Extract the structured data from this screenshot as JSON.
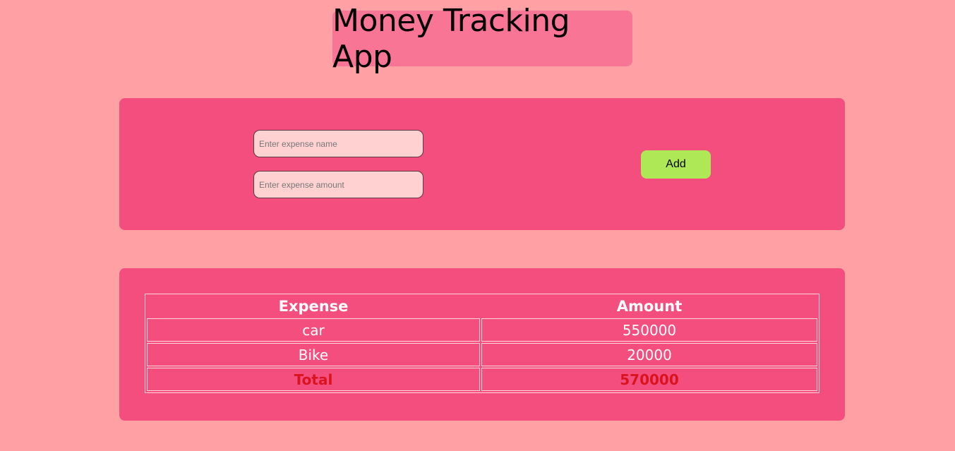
{
  "app": {
    "title": "Money Tracking App"
  },
  "form": {
    "name_placeholder": "Enter expense name",
    "amount_placeholder": "Enter expense amount",
    "add_label": "Add"
  },
  "table": {
    "headers": [
      "Expense",
      "Amount"
    ],
    "rows": [
      {
        "expense": "car",
        "amount": "550000"
      },
      {
        "expense": "Bike",
        "amount": "20000"
      }
    ],
    "total": {
      "label": "Total",
      "amount": "570000"
    }
  },
  "colors": {
    "page_background": "#fea0a4",
    "title_background": "#f87596",
    "panel_background": "#f34e7e",
    "input_background": "#ffd2d1",
    "add_button": "#aee856",
    "total_text": "#d9141e"
  }
}
